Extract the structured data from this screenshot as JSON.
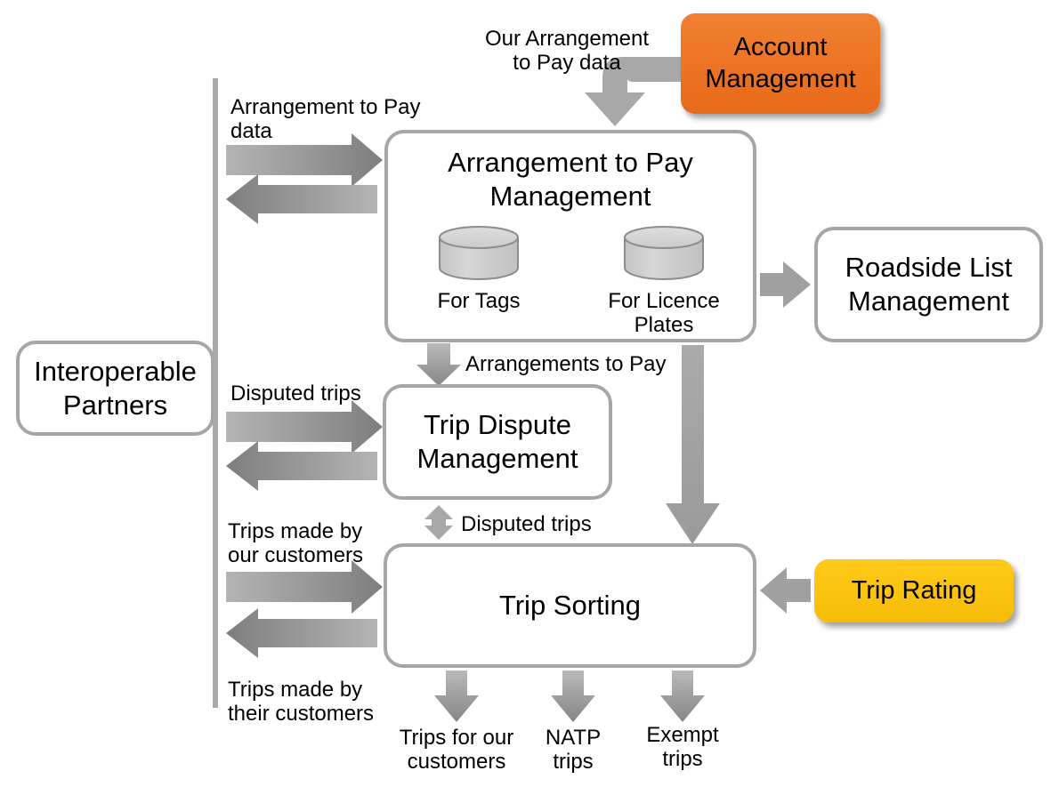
{
  "diagram": {
    "title": "Arrangement to Pay / Trip Sorting process flow",
    "colors": {
      "accent_orange": "#ee7526",
      "accent_yellow": "#fcc40f",
      "box_outline": "#a6a6a6",
      "arrow_grey": "#a0a0a0",
      "arrow_grey_dark": "#808080",
      "cylinder_fill": "#cfcfcf",
      "text": "#000000",
      "background": "#ffffff"
    }
  },
  "boxes": {
    "interoperable_partners": {
      "label": "Interoperable\nPartners"
    },
    "arrangement_to_pay_management": {
      "label": "Arrangement to Pay\nManagement"
    },
    "trip_dispute_management": {
      "label": "Trip Dispute\nManagement"
    },
    "trip_sorting": {
      "label": "Trip Sorting"
    },
    "roadside_list_management": {
      "label": "Roadside List\nManagement"
    },
    "account_management": {
      "label": "Account\nManagement"
    },
    "trip_rating": {
      "label": "Trip Rating"
    }
  },
  "datastores": {
    "for_tags": {
      "label": "For Tags"
    },
    "for_licence_plates": {
      "label": "For Licence\nPlates"
    }
  },
  "flow_labels": {
    "our_arrangement_to_pay_data": "Our Arrangement\nto Pay data",
    "arrangement_to_pay_data": "Arrangement to Pay\ndata",
    "arrangements_to_pay": "Arrangements to Pay",
    "disputed_trips_in": "Disputed trips",
    "disputed_trips_vertical": "Disputed trips",
    "trips_made_by_our_customers": "Trips made by\nour customers",
    "trips_made_by_their_customers": "Trips made by\ntheir customers"
  },
  "outputs": {
    "trips_for_our_customers": "Trips for our\ncustomers",
    "natp_trips": "NATP\ntrips",
    "exempt_trips": "Exempt\ntrips"
  }
}
